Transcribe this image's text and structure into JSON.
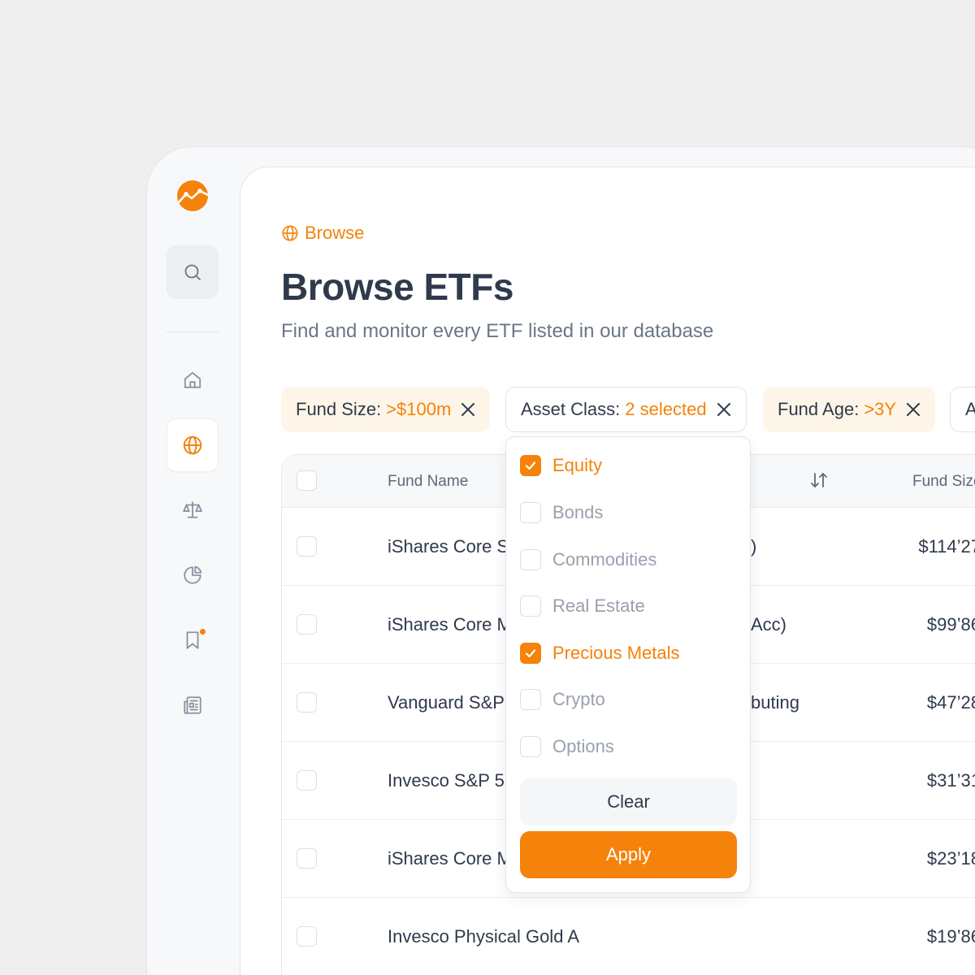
{
  "breadcrumb": {
    "label": "Browse",
    "icon": "globe-icon"
  },
  "header": {
    "title": "Browse ETFs",
    "subtitle": "Find and monitor every ETF listed in our database"
  },
  "filters": [
    {
      "label": "Fund Size:",
      "value": ">$100m"
    },
    {
      "label": "Asset Class:",
      "value": "2 selected"
    },
    {
      "label": "Fund Age:",
      "value": ">3Y"
    },
    {
      "label": "A",
      "value": ""
    }
  ],
  "table": {
    "columns": {
      "name": "Fund Name",
      "size": "Fund Size"
    },
    "rows": [
      {
        "name": "iShares Core S",
        "tail": ")",
        "size": "$114’27"
      },
      {
        "name": "iShares Core M",
        "tail": "Acc)",
        "size": "$99’86"
      },
      {
        "name": "Vanguard S&P",
        "tail": "buting",
        "size": "$47’28"
      },
      {
        "name": "Invesco S&P 5",
        "tail": "",
        "size": "$31’31"
      },
      {
        "name": "iShares Core M",
        "tail": "",
        "size": "$23’18"
      },
      {
        "name": "Invesco Physical Gold A",
        "tail": "",
        "size": "$19’86"
      }
    ]
  },
  "dropdown": {
    "options": [
      {
        "label": "Equity",
        "checked": true
      },
      {
        "label": "Bonds",
        "checked": false
      },
      {
        "label": "Commodities",
        "checked": false
      },
      {
        "label": "Real Estate",
        "checked": false
      },
      {
        "label": "Precious Metals",
        "checked": true
      },
      {
        "label": "Crypto",
        "checked": false
      },
      {
        "label": "Options",
        "checked": false
      }
    ],
    "clear_label": "Clear",
    "apply_label": "Apply"
  },
  "sidebar": {
    "items": [
      {
        "icon": "home-icon"
      },
      {
        "icon": "globe-icon",
        "active": true
      },
      {
        "icon": "scale-icon"
      },
      {
        "icon": "pie-chart-icon"
      },
      {
        "icon": "bookmark-icon",
        "badge": true
      },
      {
        "icon": "newspaper-icon"
      }
    ]
  },
  "colors": {
    "accent": "#f5820a",
    "text": "#2f3a4c",
    "muted": "#6c7686",
    "chip_bg": "#fdf6e8"
  }
}
